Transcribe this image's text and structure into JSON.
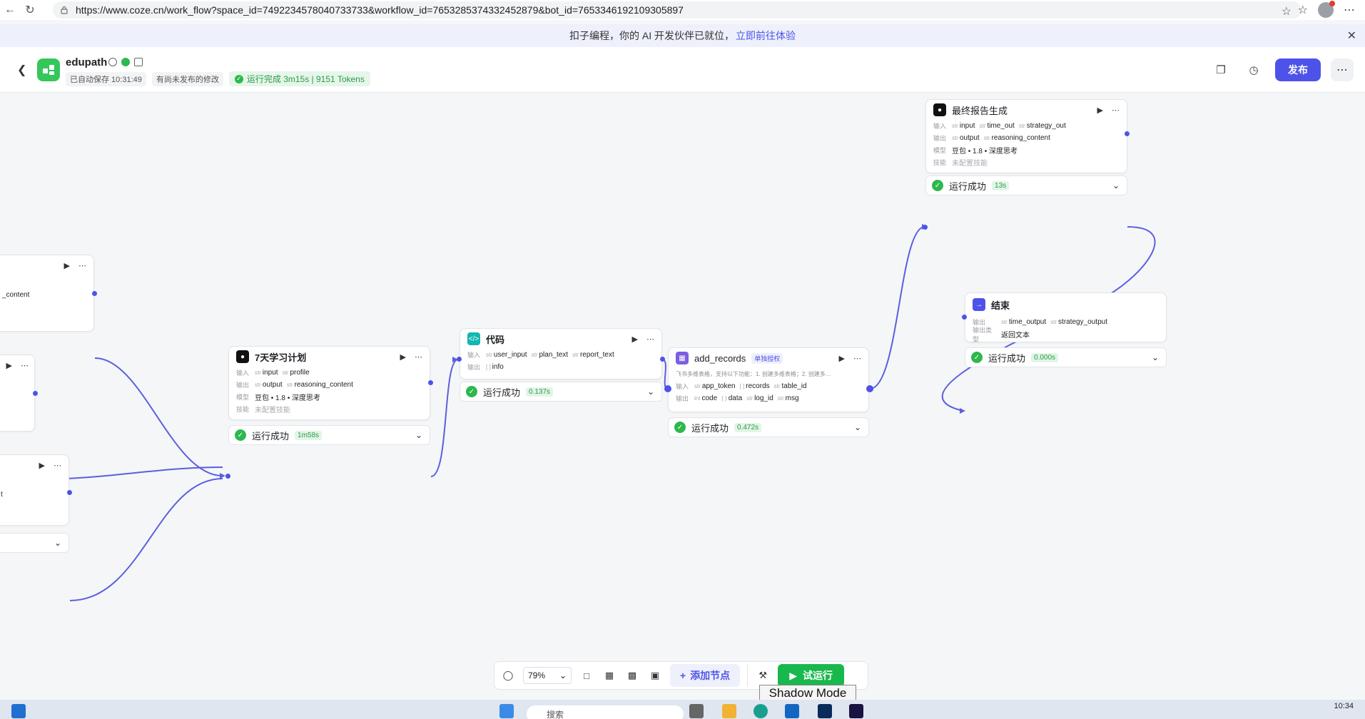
{
  "browser": {
    "url": "https://www.coze.cn/work_flow?space_id=7492234578040733733&workflow_id=7653285374332452879&bot_id=7653346192109305897"
  },
  "banner": {
    "text": "扣子编程，你的 AI 开发伙伴已就位，",
    "link": "立即前往体验"
  },
  "header": {
    "app_name": "edupath",
    "autosave": "已自动保存 10:31:49",
    "unpublished": "有尚未发布的修改",
    "run_status": "运行完成 3m15s | 9151 Tokens",
    "publish_label": "发布"
  },
  "nodes": {
    "left1": {
      "output_partial": "_content"
    },
    "left3": {
      "output_partial": "t"
    },
    "plan": {
      "title": "7天学习计划",
      "in_label": "输入",
      "out_label": "输出",
      "model_label": "模型",
      "skill_label": "技能",
      "inputs": [
        "input",
        "profile"
      ],
      "outputs": [
        "output",
        "reasoning_content"
      ],
      "model": "豆包 • 1.8 • 深度思考",
      "skill": "未配置技能",
      "status": "运行成功",
      "time": "1m58s"
    },
    "code": {
      "title": "代码",
      "in_label": "输入",
      "out_label": "输出",
      "inputs": [
        "user_input",
        "plan_text",
        "report_text"
      ],
      "outputs": [
        "info"
      ],
      "status": "运行成功",
      "time": "0.137s"
    },
    "records": {
      "title": "add_records",
      "badge": "单独授权",
      "desc": "飞书多维表格，支持以下功能：1. 创建多维表格；2. 创建多…",
      "in_label": "输入",
      "out_label": "输出",
      "inputs": [
        "app_token",
        "records",
        "table_id"
      ],
      "outputs": [
        "code",
        "data",
        "log_id",
        "msg"
      ],
      "status": "运行成功",
      "time": "0.472s"
    },
    "report": {
      "title": "最终报告生成",
      "in_label": "输入",
      "out_label": "输出",
      "model_label": "模型",
      "skill_label": "技能",
      "inputs": [
        "input",
        "time_out",
        "strategy_out"
      ],
      "outputs": [
        "output",
        "reasoning_content"
      ],
      "model": "豆包 • 1.8 • 深度思考",
      "skill": "未配置技能",
      "status": "运行成功",
      "time": "13s"
    },
    "end": {
      "title": "结束",
      "out_label": "输出",
      "outtype_label": "输出类型",
      "outputs": [
        "time_output",
        "strategy_output"
      ],
      "outtype": "返回文本",
      "status": "运行成功",
      "time": "0.000s"
    }
  },
  "toolbar": {
    "zoom": "79%",
    "add_node": "添加节点",
    "try_run": "试运行"
  },
  "overlay": {
    "shadow_mode": "Shadow Mode"
  },
  "taskbar": {
    "search": "搜索",
    "clock": "10:34"
  },
  "colors": {
    "accent": "#4d53e8",
    "success": "#2db84d",
    "run_button": "#19b84c"
  }
}
